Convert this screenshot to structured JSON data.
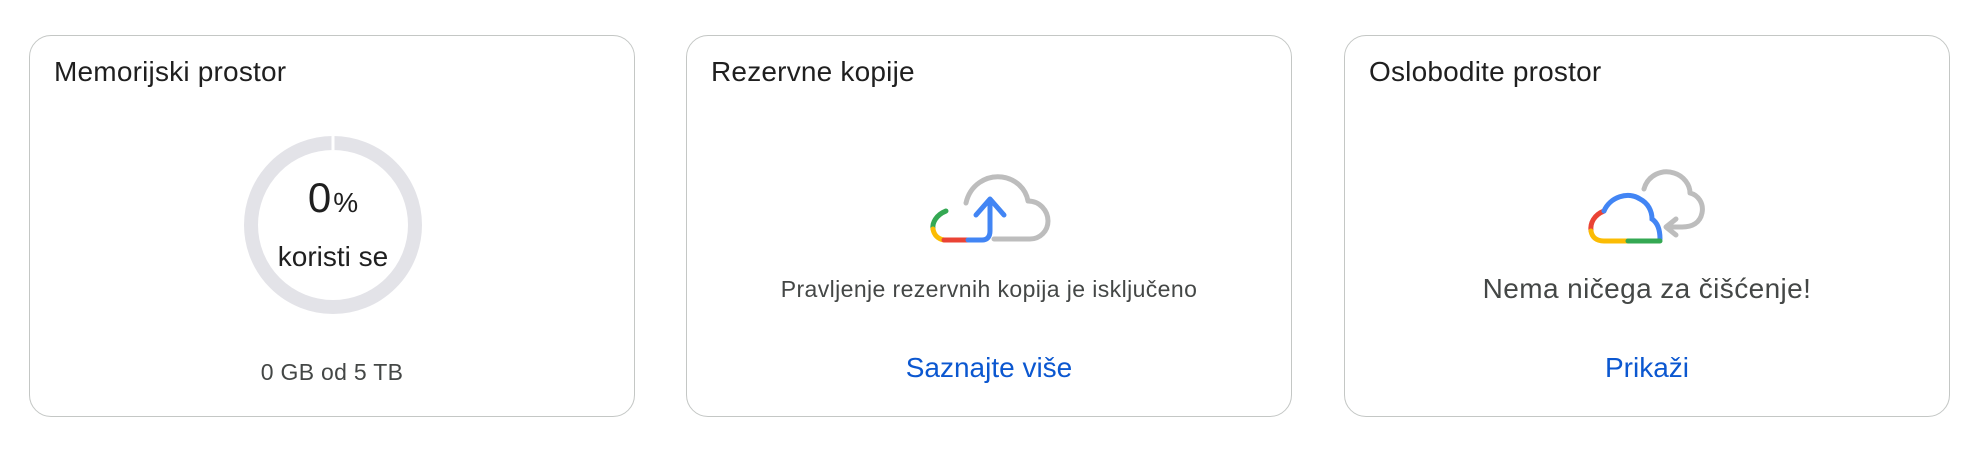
{
  "storage": {
    "title": "Memorijski prostor",
    "percent_value": "0",
    "percent_sign": "%",
    "in_use_label": "koristi se",
    "usage_text": "0 GB od 5 TB",
    "used_fraction": 0.0
  },
  "backup": {
    "title": "Rezervne kopije",
    "icon": "cloud-upload-icon",
    "status_text": "Pravljenje rezervnih kopija je isključeno",
    "link_label": "Saznajte više"
  },
  "free_space": {
    "title": "Oslobodite prostor",
    "icon": "cloud-refresh-icon",
    "status_text": "Nema ničega za čišćenje!",
    "link_label": "Prikaži"
  },
  "colors": {
    "link": "#0b57d0",
    "ring_track": "#e3e3e8",
    "google_blue": "#4285f4",
    "google_red": "#ea4335",
    "google_yellow": "#fbbc04",
    "google_green": "#34a853",
    "cloud_gray": "#bdbdbd"
  }
}
